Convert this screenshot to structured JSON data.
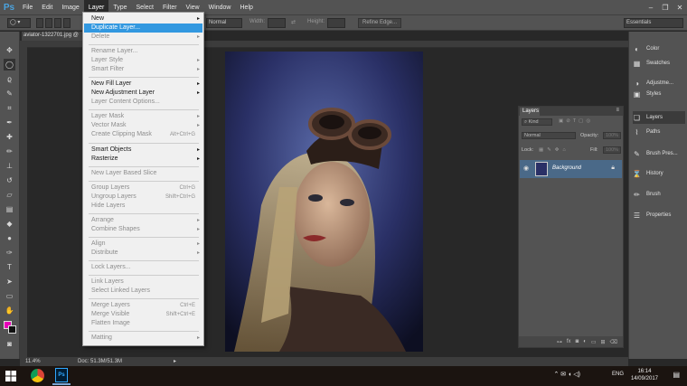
{
  "app": {
    "logo": "Ps",
    "menus": [
      "File",
      "Edit",
      "Image",
      "Layer",
      "Type",
      "Select",
      "Filter",
      "View",
      "Window",
      "Help"
    ],
    "active_menu": "Layer",
    "window_controls": [
      "–",
      "❐",
      "✕"
    ]
  },
  "options_bar": {
    "mode_value": "Normal",
    "width_label": "Width:",
    "height_label": "Height:",
    "refine_edge_label": "Refine Edge...",
    "workspace": "Essentials"
  },
  "document": {
    "tab_label": "aviator-1322701.jpg @",
    "zoom": "11.4%",
    "doc_size": "Doc: 51.3M/51.3M"
  },
  "layer_menu": {
    "items": [
      {
        "label": "New",
        "submenu": true,
        "state": "normal"
      },
      {
        "label": "Duplicate Layer...",
        "state": "highlight"
      },
      {
        "label": "Delete",
        "submenu": true,
        "state": "disabled"
      },
      {
        "label": "Rename Layer...",
        "state": "disabled"
      },
      {
        "label": "Layer Style",
        "submenu": true,
        "state": "disabled"
      },
      {
        "label": "Smart Filter",
        "submenu": true,
        "state": "disabled"
      },
      {
        "label": "New Fill Layer",
        "submenu": true,
        "state": "normal"
      },
      {
        "label": "New Adjustment Layer",
        "submenu": true,
        "state": "normal"
      },
      {
        "label": "Layer Content Options...",
        "state": "disabled"
      },
      {
        "label": "Layer Mask",
        "submenu": true,
        "state": "disabled"
      },
      {
        "label": "Vector Mask",
        "submenu": true,
        "state": "disabled"
      },
      {
        "label": "Create Clipping Mask",
        "shortcut": "Alt+Ctrl+G",
        "state": "disabled"
      },
      {
        "label": "Smart Objects",
        "submenu": true,
        "state": "normal"
      },
      {
        "label": "Rasterize",
        "submenu": true,
        "state": "normal"
      },
      {
        "label": "New Layer Based Slice",
        "state": "disabled"
      },
      {
        "label": "Group Layers",
        "shortcut": "Ctrl+G",
        "state": "disabled"
      },
      {
        "label": "Ungroup Layers",
        "shortcut": "Shift+Ctrl+G",
        "state": "disabled"
      },
      {
        "label": "Hide Layers",
        "state": "disabled"
      },
      {
        "label": "Arrange",
        "submenu": true,
        "state": "disabled"
      },
      {
        "label": "Combine Shapes",
        "submenu": true,
        "state": "disabled"
      },
      {
        "label": "Align",
        "submenu": true,
        "state": "disabled"
      },
      {
        "label": "Distribute",
        "submenu": true,
        "state": "disabled"
      },
      {
        "label": "Lock Layers...",
        "state": "disabled"
      },
      {
        "label": "Link Layers",
        "state": "disabled"
      },
      {
        "label": "Select Linked Layers",
        "state": "disabled"
      },
      {
        "label": "Merge Layers",
        "shortcut": "Ctrl+E",
        "state": "disabled"
      },
      {
        "label": "Merge Visible",
        "shortcut": "Shift+Ctrl+E",
        "state": "disabled"
      },
      {
        "label": "Flatten Image",
        "state": "disabled"
      },
      {
        "label": "Matting",
        "submenu": true,
        "state": "disabled"
      }
    ]
  },
  "dock": {
    "items": [
      "Color",
      "Swatches",
      "Adjustme...",
      "Styles",
      "Layers",
      "Paths",
      "Brush Pres...",
      "History",
      "Brush",
      "Properties"
    ]
  },
  "layers_panel": {
    "tab": "Layers",
    "kind_label": "Kind",
    "blend_mode": "Normal",
    "opacity_label": "Opacity:",
    "opacity_value": "100%",
    "lock_label": "Lock:",
    "fill_label": "Fill:",
    "fill_value": "100%",
    "layer_name": "Background"
  },
  "taskbar": {
    "language": "ENG",
    "time": "16:14",
    "date": "14/09/2017"
  },
  "colors": {
    "foreground": "#e600b8",
    "background": "#111111",
    "menu_highlight": "#3298e0",
    "selected_layer": "#4a6988"
  }
}
